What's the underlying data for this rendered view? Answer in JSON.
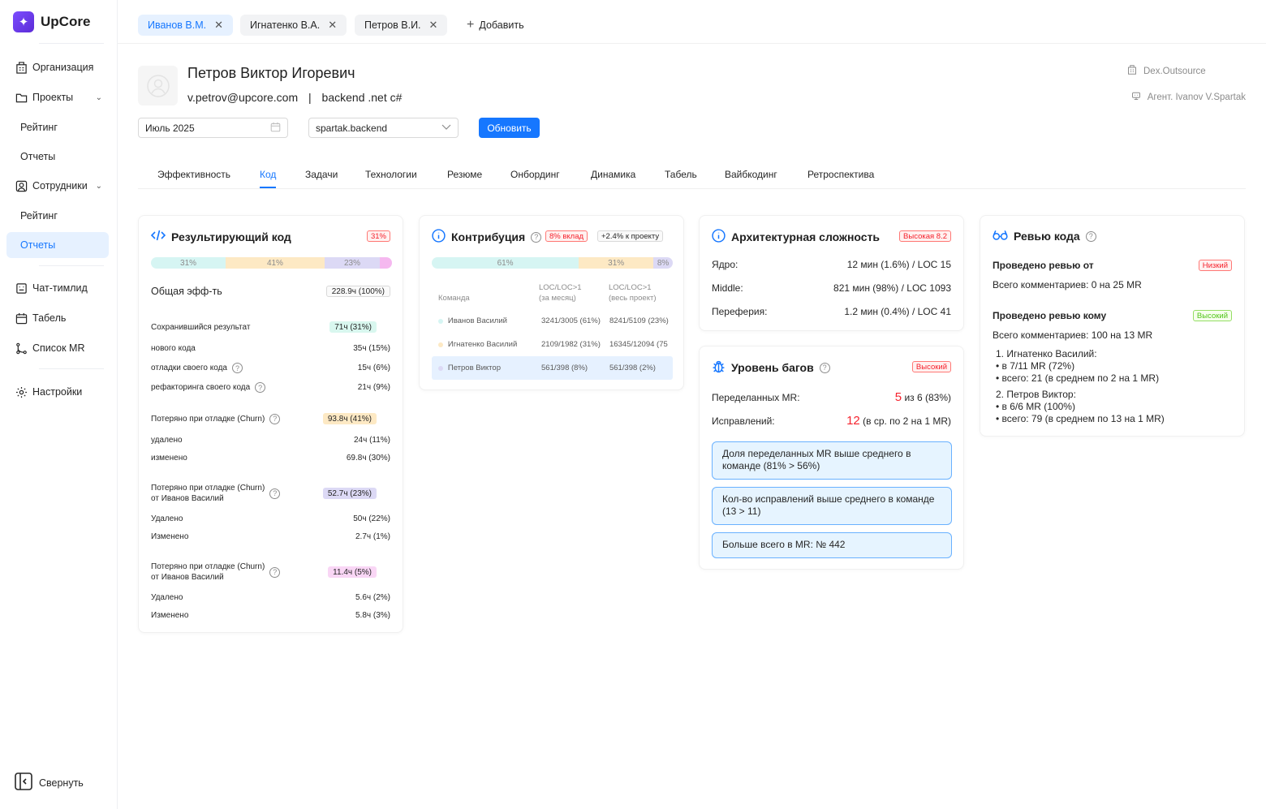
{
  "app": {
    "name": "UpCore"
  },
  "sidebar": {
    "items": [
      {
        "label": "Организация",
        "icon": "building-icon"
      },
      {
        "label": "Проекты",
        "icon": "folder-icon"
      },
      {
        "label": "Рейтинг"
      },
      {
        "label": "Отчеты"
      },
      {
        "label": "Сотрудники",
        "icon": "user-square-icon"
      },
      {
        "label": "Рейтинг"
      },
      {
        "label": "Отчеты"
      },
      {
        "label": "Чат-тимлид",
        "icon": "chat-bot-icon"
      },
      {
        "label": "Табель",
        "icon": "calendar-icon"
      },
      {
        "label": "Список MR",
        "icon": "merge-icon"
      },
      {
        "label": "Настройки",
        "icon": "gear-icon"
      }
    ],
    "collapse": "Свернуть"
  },
  "person_tabs": [
    {
      "label": "Иванов В.М."
    },
    {
      "label": "Игнатенко В.А."
    },
    {
      "label": "Петров В.И."
    }
  ],
  "add_label": "Добавить",
  "profile": {
    "name": "Петров Виктор Игоревич",
    "email": "v.petrov@upcore.com",
    "sep": "|",
    "role": "backend .net c#",
    "company": "Dex.Outsource",
    "agent": "Агент. Ivanov V.Spartak"
  },
  "filters": {
    "month": "Июль 2025",
    "repo": "spartak.backend",
    "update": "Обновить"
  },
  "tabs": [
    "Эффективность",
    "Код",
    "Задачи",
    "Технологии",
    "Резюме",
    "Онбординг",
    "Динамика",
    "Табель",
    "Вайбкодинг",
    "Ретроспектива"
  ],
  "code": {
    "title": "Результирующий код",
    "tag": "31%",
    "bar": [
      {
        "label": "31%",
        "value": 31,
        "color": "#d6f5f3"
      },
      {
        "label": "41%",
        "value": 41,
        "color": "#fde9c4"
      },
      {
        "label": "23%",
        "value": 23,
        "color": "#dcd9f5"
      },
      {
        "label": "",
        "value": 5,
        "color": "#f5b8ef"
      }
    ],
    "total_label": "Общая эфф-ть",
    "total_value": "228.9ч (100%)",
    "saved": {
      "label": "Сохранившийся результат",
      "value": "71ч (31%)",
      "rows": [
        [
          "нового кода",
          "35ч (15%)"
        ],
        [
          "отладки своего кода",
          "15ч (6%)"
        ],
        [
          "рефакторинга своего кода",
          "21ч (9%)"
        ]
      ]
    },
    "churn1": {
      "label": "Потеряно при отладке (Churn)",
      "value": "93.8ч (41%)",
      "rows": [
        [
          "удалено",
          "24ч (11%)"
        ],
        [
          "изменено",
          "69.8ч (30%)"
        ]
      ]
    },
    "churn2": {
      "label1": "Потеряно при отладке (Churn)",
      "label2": "от Иванов Василий",
      "value": "52.7ч (23%)",
      "rows": [
        [
          "Удалено",
          "50ч (22%)"
        ],
        [
          "Изменено",
          "2.7ч (1%)"
        ]
      ]
    },
    "churn3": {
      "label1": "Потеряно при отладке (Churn)",
      "label2": "от Иванов Василий",
      "value": "11.4ч (5%)",
      "rows": [
        [
          "Удалено",
          "5.6ч (2%)"
        ],
        [
          "Изменено",
          "5.8ч (3%)"
        ]
      ]
    }
  },
  "contrib": {
    "title": "Контрибуция",
    "tag1": "8% вклад",
    "tag2": "+2.4% к проекту",
    "bar": [
      {
        "label": "61%",
        "value": 61,
        "color": "#d6f5f3"
      },
      {
        "label": "31%",
        "value": 31,
        "color": "#fde9c4"
      },
      {
        "label": "8%",
        "value": 8,
        "color": "#dcd9f5"
      }
    ],
    "headers": {
      "team": "Команда",
      "month1": "LOC/LOC>1",
      "month2": "(за месяц)",
      "all1": "LOC/LOC>1",
      "all2": "(весь проект)"
    },
    "rows": [
      {
        "name": "Иванов Василий",
        "month": "3241/3005 (61%)",
        "all": "8241/5109 (23%)",
        "color": "#d6f5f3"
      },
      {
        "name": "Игнатенко Василий",
        "month": "2109/1982 (31%)",
        "all": "16345/12094 (75",
        "color": "#fde9c4"
      },
      {
        "name": "Петров Виктор",
        "month": "561/398 (8%)",
        "all": "561/398 (2%)",
        "color": "#dcd9f5"
      }
    ]
  },
  "arch": {
    "title": "Архитектурная сложность",
    "tag": "Высокая 8.2",
    "rows": [
      [
        "Ядро:",
        "12 мин (1.6%) / LOC 15"
      ],
      [
        "Middle:",
        "821 мин (98%) / LOC 1093"
      ],
      [
        "Переферия:",
        "1.2 мин (0.4%) / LOC 41"
      ]
    ]
  },
  "bugs": {
    "title": "Уровень багов",
    "tag": "Высокий",
    "remade_label": "Переделанных MR:",
    "remade_big": "5",
    "remade_rest": "из 6 (83%)",
    "fixes_label": "Исправлений:",
    "fixes_big": "12",
    "fixes_rest": "(в ср. по 2 на 1 MR)",
    "alerts": [
      "Доля переделанных MR выше среднего в команде (81% > 56%)",
      "Кол-во исправлений выше среднего в команде (13 > 11)",
      "Больше всего в MR: № 442"
    ]
  },
  "review": {
    "title": "Ревью кода",
    "from_label": "Проведено ревью от",
    "from_tag": "Низкий",
    "from_text": "Всего комментариев: 0 на 25 MR",
    "to_label": "Проведено ревью кому",
    "to_tag": "Высокий",
    "to_text": "Всего комментариев: 100 на 13 MR",
    "list": [
      {
        "name": "1. Игнатенко Василий:",
        "items": [
          "в 7/11 MR (72%)",
          "всего: 21 (в среднем по 2 на 1 MR)"
        ]
      },
      {
        "name": "2. Петров Виктор:",
        "items": [
          "в 6/6 MR (100%)",
          "всего: 79 (в среднем по 13 на 1 MR)"
        ]
      }
    ]
  },
  "colors": {
    "accent": "#1677ff",
    "danger": "#f5222d"
  }
}
